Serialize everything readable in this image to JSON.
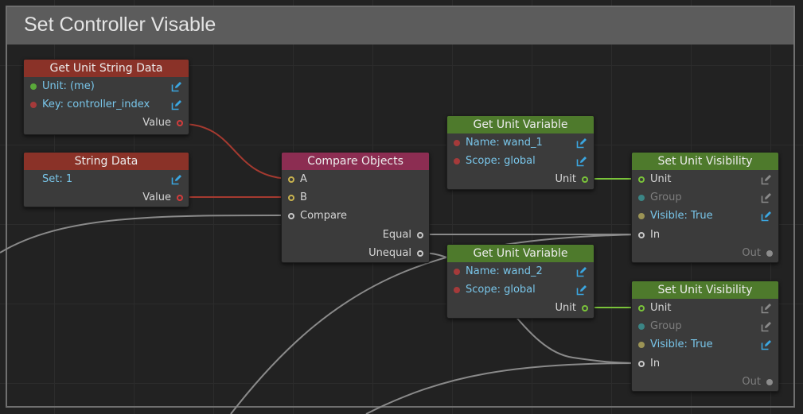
{
  "group": {
    "title": "Set Controller Visable"
  },
  "colors": {
    "header_red": "#8a3228",
    "header_pink": "#8c2d52",
    "header_green": "#4e7a2c",
    "wire_red": "#a53a30",
    "wire_green": "#7ac33a",
    "wire_gray": "#8a8a8a",
    "edit_active": "#3ba6e0",
    "edit_inactive": "#8a8a8a"
  },
  "nodes": {
    "get_unit_string_data": {
      "title": "Get Unit String Data",
      "unit_label": "Unit: (me)",
      "key_label": "Key: controller_index",
      "value_label": "Value"
    },
    "string_data": {
      "title": "String Data",
      "set_label": "Set: 1",
      "value_label": "Value"
    },
    "compare_objects": {
      "title": "Compare Objects",
      "a_label": "A",
      "b_label": "B",
      "compare_label": "Compare",
      "equal_label": "Equal",
      "unequal_label": "Unequal"
    },
    "get_unit_variable_1": {
      "title": "Get Unit Variable",
      "name_label": "Name: wand_1",
      "scope_label": "Scope: global",
      "unit_label": "Unit"
    },
    "get_unit_variable_2": {
      "title": "Get Unit Variable",
      "name_label": "Name: wand_2",
      "scope_label": "Scope: global",
      "unit_label": "Unit"
    },
    "set_unit_visibility_1": {
      "title": "Set Unit Visibility",
      "unit_label": "Unit",
      "group_label": "Group",
      "visible_label": "Visible: True",
      "in_label": "In",
      "out_label": "Out"
    },
    "set_unit_visibility_2": {
      "title": "Set Unit Visibility",
      "unit_label": "Unit",
      "group_label": "Group",
      "visible_label": "Visible: True",
      "in_label": "In",
      "out_label": "Out"
    }
  }
}
